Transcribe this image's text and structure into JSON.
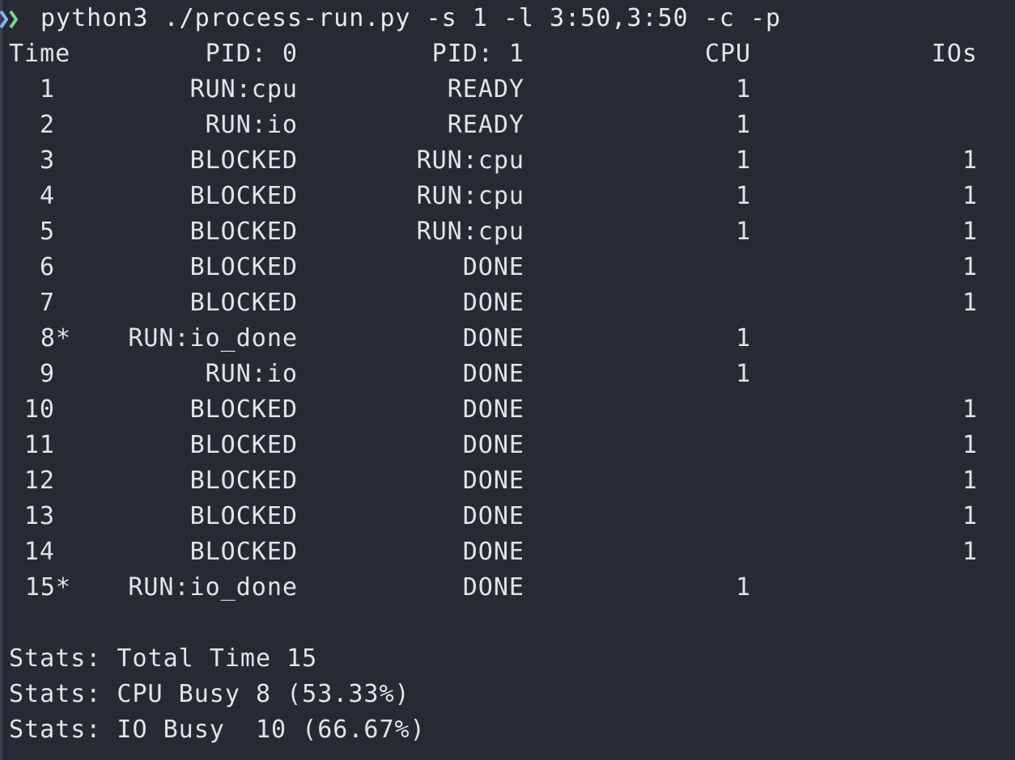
{
  "prompt": {
    "arrow_color_blue": "#8ab4f8",
    "arrow_color_green": "#7bd88f",
    "command": "python3 ./process-run.py -s 1 -l 3:50,3:50 -c -p"
  },
  "table": {
    "headers": {
      "time": "Time",
      "pid0": "PID: 0",
      "pid1": "PID: 1",
      "cpu": "CPU",
      "ios": "IOs"
    },
    "rows": [
      {
        "time": "1",
        "pid0": "RUN:cpu",
        "pid1": "READY",
        "cpu": "1",
        "ios": ""
      },
      {
        "time": "2",
        "pid0": "RUN:io",
        "pid1": "READY",
        "cpu": "1",
        "ios": ""
      },
      {
        "time": "3",
        "pid0": "BLOCKED",
        "pid1": "RUN:cpu",
        "cpu": "1",
        "ios": "1"
      },
      {
        "time": "4",
        "pid0": "BLOCKED",
        "pid1": "RUN:cpu",
        "cpu": "1",
        "ios": "1"
      },
      {
        "time": "5",
        "pid0": "BLOCKED",
        "pid1": "RUN:cpu",
        "cpu": "1",
        "ios": "1"
      },
      {
        "time": "6",
        "pid0": "BLOCKED",
        "pid1": "DONE",
        "cpu": "",
        "ios": "1"
      },
      {
        "time": "7",
        "pid0": "BLOCKED",
        "pid1": "DONE",
        "cpu": "",
        "ios": "1"
      },
      {
        "time": "8*",
        "pid0": "RUN:io_done",
        "pid1": "DONE",
        "cpu": "1",
        "ios": ""
      },
      {
        "time": "9",
        "pid0": "RUN:io",
        "pid1": "DONE",
        "cpu": "1",
        "ios": ""
      },
      {
        "time": "10",
        "pid0": "BLOCKED",
        "pid1": "DONE",
        "cpu": "",
        "ios": "1"
      },
      {
        "time": "11",
        "pid0": "BLOCKED",
        "pid1": "DONE",
        "cpu": "",
        "ios": "1"
      },
      {
        "time": "12",
        "pid0": "BLOCKED",
        "pid1": "DONE",
        "cpu": "",
        "ios": "1"
      },
      {
        "time": "13",
        "pid0": "BLOCKED",
        "pid1": "DONE",
        "cpu": "",
        "ios": "1"
      },
      {
        "time": "14",
        "pid0": "BLOCKED",
        "pid1": "DONE",
        "cpu": "",
        "ios": "1"
      },
      {
        "time": "15*",
        "pid0": "RUN:io_done",
        "pid1": "DONE",
        "cpu": "1",
        "ios": ""
      }
    ]
  },
  "stats": [
    "Stats: Total Time 15",
    "Stats: CPU Busy 8 (53.33%)",
    "Stats: IO Busy  10 (66.67%)"
  ]
}
